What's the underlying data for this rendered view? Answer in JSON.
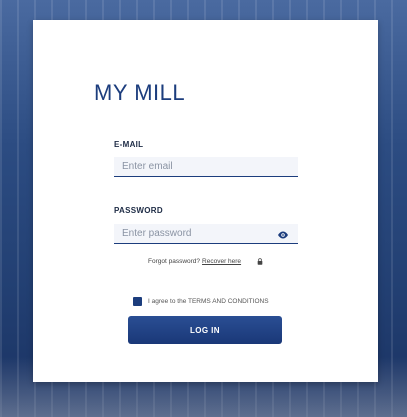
{
  "app": {
    "title": "MY MILL"
  },
  "form": {
    "email_label": "E-MAIL",
    "email_placeholder": "Enter email",
    "email_value": "",
    "password_label": "PASSWORD",
    "password_placeholder": "Enter password",
    "password_value": "",
    "forgot_text": "Forgot password?",
    "recover_link": "Recover here",
    "terms_text": "I agree to the TERMS AND CONDITIONS",
    "terms_checked": true,
    "login_label": "LOG IN"
  },
  "icons": {
    "password_toggle": "eye-icon",
    "recover": "lock-icon",
    "agree": "checkbox"
  },
  "colors": {
    "brand": "#1c3d7d",
    "button": "#1f4185",
    "card": "#ffffff"
  }
}
